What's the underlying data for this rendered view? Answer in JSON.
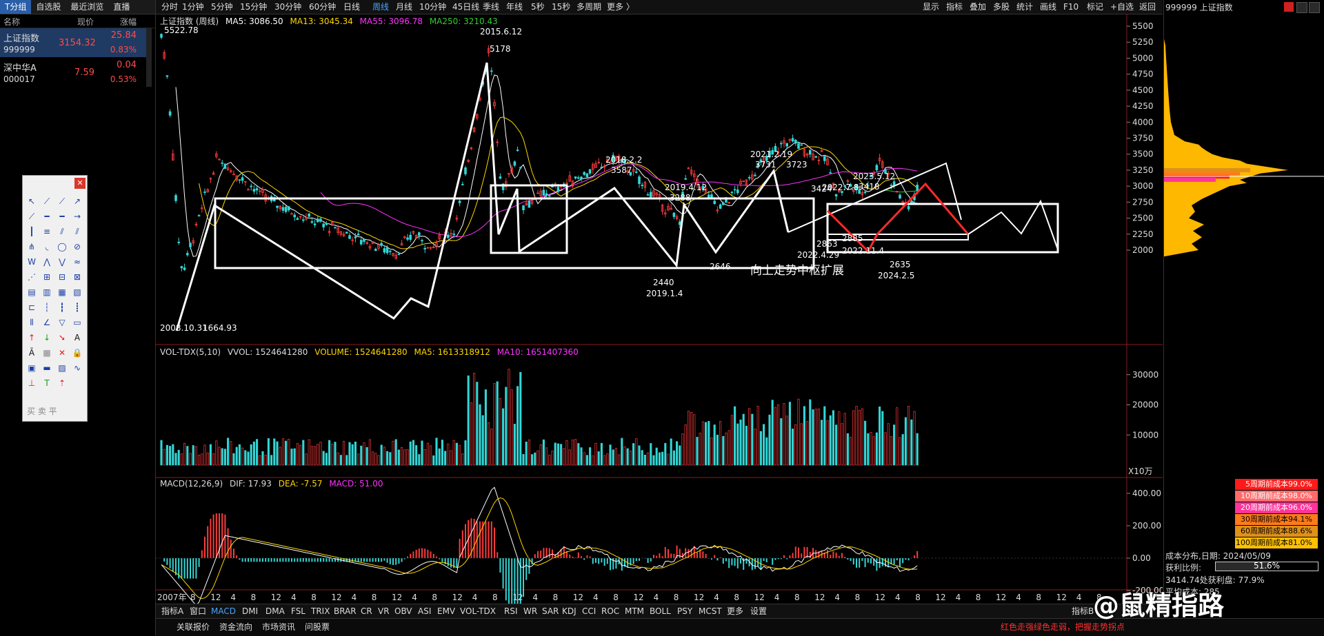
{
  "left_panel": {
    "tabs": [
      "T分组",
      "自选股",
      "最近浏览",
      "直播"
    ],
    "header": {
      "name": "名称",
      "price": "现价",
      "change": "涨幅"
    },
    "stocks": [
      {
        "name": "上证指数",
        "code": "999999",
        "price": "3154.32",
        "change": "25.84",
        "pct": "0.83%"
      },
      {
        "name": "深中华A",
        "code": "000017",
        "price": "7.59",
        "change": "0.04",
        "pct": "0.53%"
      }
    ]
  },
  "topbar": {
    "periods": [
      "分时",
      "1分钟",
      "5分钟",
      "15分钟",
      "30分钟",
      "60分钟",
      "日线",
      "周线",
      "月线",
      "10分钟",
      "45日线",
      "季线",
      "年线",
      "5秒",
      "15秒",
      "多周期",
      "更多 〉"
    ],
    "active_period": "周线",
    "tools": [
      "显示",
      "指标",
      "叠加",
      "多股",
      "统计",
      "画线",
      "F10",
      "标记",
      "+自选",
      "返回"
    ]
  },
  "main_legend": {
    "title": "上证指数 (周线)",
    "ma5": "MA5: 3086.50",
    "ma13": "MA13: 3045.34",
    "ma55": "MA55: 3096.78",
    "ma250": "MA250: 3210.43",
    "colors": {
      "ma5": "#ffffff",
      "ma13": "#ffd700",
      "ma55": "#ff33ff",
      "ma250": "#33cc33"
    }
  },
  "price_axis": [
    "5500",
    "5250",
    "5000",
    "4750",
    "4500",
    "4250",
    "4000",
    "3750",
    "3500",
    "3250",
    "3000",
    "2750",
    "2500",
    "2250",
    "2000"
  ],
  "annotations": {
    "high_2007": "5522.78",
    "low_2008_date": "2008.10.31",
    "low_2008": "1664.93",
    "peak_2015_date": "2015.6.12",
    "peak_2015": "5178",
    "peak_2018_date": "2018.2.2",
    "peak_2018": "3587",
    "low_2019_value": "2440",
    "low_2019_date": "2019.1.4",
    "peak_2019_date": "2019.4.12",
    "peak_2019": "3288",
    "low_2646": "2646",
    "peak_2021_date": "2021.2.19",
    "peak_2021": "3731",
    "peak_3723": "3723",
    "peak_3424": "3424",
    "date_2022_7_8": "2022.7.8",
    "low_2863": "2863",
    "date_2022_4_29": "2022.4.29",
    "low_2885": "2885",
    "date_2022_11_4": "2022.11.4",
    "peak_2023_date": "2023.5.12",
    "peak_2023": "3418",
    "low_2635": "2635",
    "low_2024_date": "2024.2.5",
    "pivot_note": "向上走势中枢扩展"
  },
  "volume_legend": {
    "name": "VOL-TDX(5,10)",
    "vvol": "VVOL: 1524641280",
    "volume": "VOLUME: 1524641280",
    "ma5": "MA5: 1613318912",
    "ma10": "MA10: 1651407360"
  },
  "volume_axis": [
    "30000",
    "20000",
    "10000"
  ],
  "volume_unit": "X10万",
  "macd_legend": {
    "name": "MACD(12,26,9)",
    "dif": "DIF: 17.93",
    "dea": "DEA: -7.57",
    "macd": "MACD: 51.00"
  },
  "macd_axis": [
    "400.00",
    "200.00",
    "0.00",
    "-200.00"
  ],
  "time_axis": {
    "start": "2007年",
    "ticks": [
      "8",
      "12",
      "4",
      "8",
      "12",
      "4",
      "8",
      "12",
      "4",
      "8",
      "12",
      "4",
      "8",
      "12",
      "4",
      "8",
      "12",
      "4",
      "8",
      "12",
      "4",
      "8",
      "12",
      "4",
      "8",
      "12",
      "4",
      "8",
      "12",
      "4",
      "8",
      "12",
      "4",
      "8",
      "12",
      "4",
      "8",
      "12",
      "4",
      "8",
      "12",
      "4",
      "8",
      "12",
      "4",
      "8"
    ]
  },
  "indicator_tabs": [
    "指标A",
    "窗口",
    "MACD",
    "DMI",
    "DMA",
    "FSL",
    "TRIX",
    "BRAR",
    "CR",
    "VR",
    "OBV",
    "ASI",
    "EMV",
    "VOL-TDX",
    "RSI",
    "WR",
    "SAR",
    "KDJ",
    "CCI",
    "ROC",
    "MTM",
    "BOLL",
    "PSY",
    "MCST",
    "更多",
    "设置"
  ],
  "active_indicator": "MACD",
  "indicator_tab_right": "指标B",
  "status_tabs": [
    "关联报价",
    "资金流向",
    "市场资讯",
    "问股票"
  ],
  "status_red_text": "红色走强绿色走弱，把握走势拐点",
  "right_panel": {
    "title": "999999 上证指数",
    "cost_rows": [
      {
        "label": "5周期前成本99.0%",
        "color": "#ff1a1a"
      },
      {
        "label": "10周期前成本98.0%",
        "color": "#ff6b6b"
      },
      {
        "label": "20周期前成本96.0%",
        "color": "#ff3399"
      },
      {
        "label": "30周期前成本94.1%",
        "color": "#ff7a1a"
      },
      {
        "label": "60周期前成本88.6%",
        "color": "#e0901a"
      },
      {
        "label": "100周期前成本81.0%",
        "color": "#ffc000"
      }
    ],
    "dist_date_label": "成本分布,日期: 2024/05/09",
    "profit_label": "获利比例:",
    "profit_value": "51.6%",
    "profit_line": "3414.74处获利盘: 77.9%",
    "avg_line": "平均成本: 285"
  },
  "watermark": "@鼠精指路"
}
